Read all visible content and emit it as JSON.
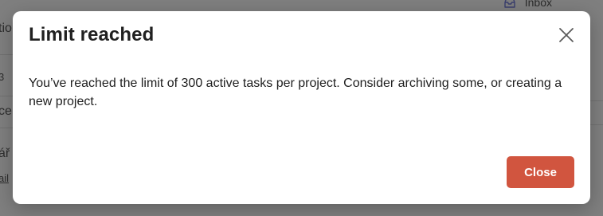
{
  "background": {
    "inbox_label": "Inbox",
    "fragments": [
      "tio",
      "3",
      "ce",
      "ář",
      "ail"
    ]
  },
  "dialog": {
    "title": "Limit reached",
    "message": "You’ve reached the limit of 300 active tasks per project. Consider archiving some, or creating a new project.",
    "close_button_label": "Close",
    "close_icon": "close-icon"
  },
  "colors": {
    "primary_button": "#d1553f",
    "overlay": "#7f7f7f"
  }
}
